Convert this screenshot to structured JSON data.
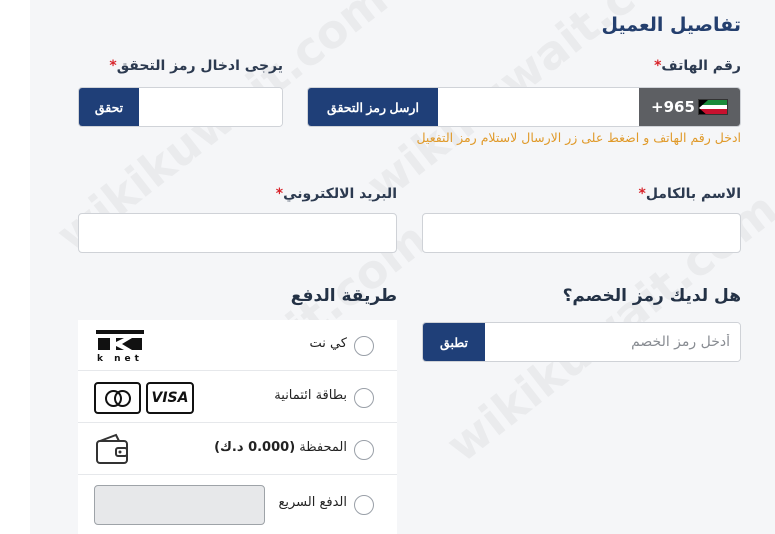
{
  "form": {
    "title": "تفاصيل العميل",
    "phone": {
      "label": "رقم الهاتف",
      "required_mark": "*",
      "prefix": "+965",
      "send_button": "ارسل رمز التحقق",
      "hint": "ادخل رقم الهاتف و اضغط على زر الارسال لاستلام رمز التفعيل"
    },
    "verification": {
      "label": "يرجى ادخال رمز التحقق",
      "required_mark": "*",
      "button": "تحقق"
    },
    "full_name": {
      "label": "الاسم بالكامل",
      "required_mark": "*"
    },
    "email": {
      "label": "البريد الالكتروني",
      "required_mark": "*"
    },
    "coupon": {
      "heading": "هل لديك رمز الخصم؟",
      "placeholder": "أدخل رمز الخصم",
      "button": "تطبق"
    },
    "payment": {
      "heading": "طريقة الدفع",
      "methods": [
        {
          "label": "كي نت",
          "icon": "knet-logo-icon"
        },
        {
          "label": "بطاقة ائتمانية",
          "icon": "credit-cards-icon"
        },
        {
          "label": "المحفظة",
          "amount": "(0.000 د.ك)",
          "icon": "wallet-icon"
        },
        {
          "label": "الدفع السريع",
          "icon": "quick-pay-field"
        }
      ],
      "knet_text": "k net",
      "visa_text": "VISA"
    }
  },
  "watermark": "wikikuwait.com",
  "colors": {
    "primary_button": "#1f3f78",
    "required": "#d8232a",
    "hint": "#e09a2a"
  }
}
